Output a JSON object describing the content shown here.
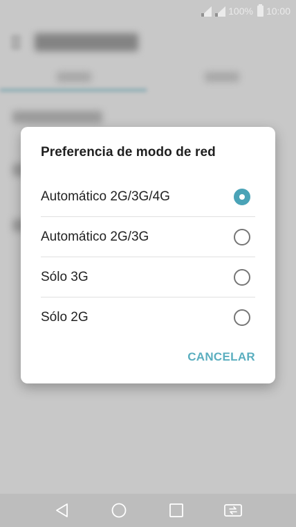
{
  "status_bar": {
    "battery_text": "100%",
    "time": "10:00",
    "icons": [
      "signal-icon-1",
      "signal-icon-2",
      "battery-icon"
    ]
  },
  "dialog": {
    "title": "Preferencia de modo de red",
    "options": [
      {
        "label": "Automático 2G/3G/4G",
        "selected": true
      },
      {
        "label": "Automático 2G/3G",
        "selected": false
      },
      {
        "label": "Sólo 3G",
        "selected": false
      },
      {
        "label": "Sólo 2G",
        "selected": false
      }
    ],
    "cancel_label": "CANCELAR"
  },
  "navigation_bar": {
    "icons": [
      "back-icon",
      "home-icon",
      "recents-icon",
      "dual-window-icon"
    ]
  },
  "colors": {
    "accent": "#4aa3b7",
    "cancel_text": "#5aaebf",
    "dialog_background": "#ffffff",
    "navbar_background": "#bdbdbd"
  }
}
